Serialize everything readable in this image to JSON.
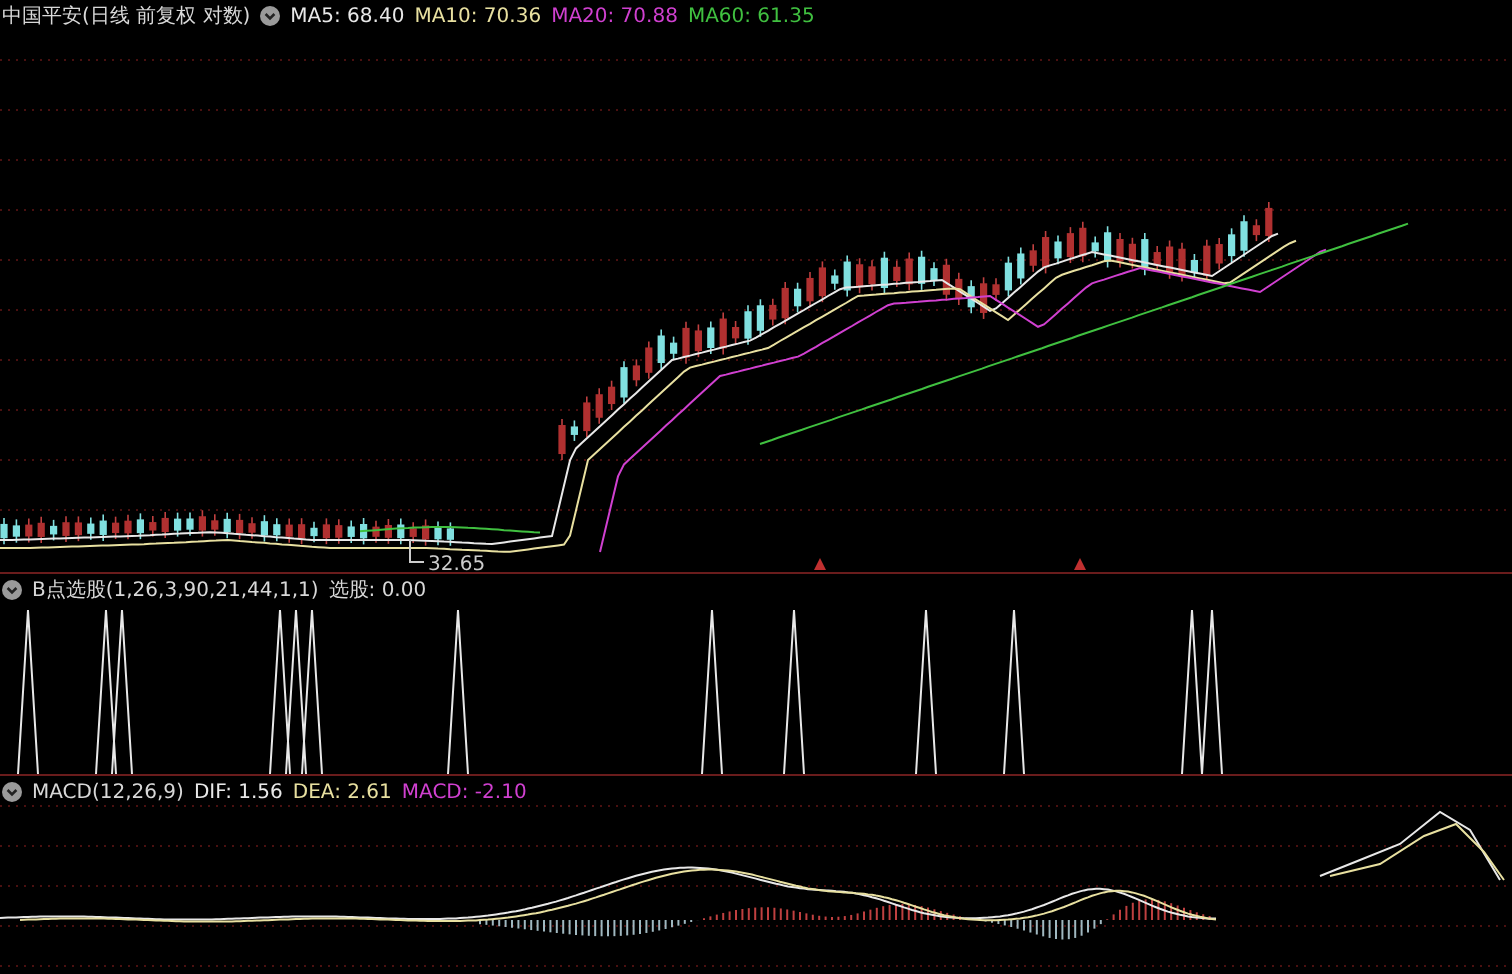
{
  "main_panel": {
    "stock_title": "中国平安(日线 前复权 对数)",
    "indicators": [
      {
        "label": "MA5: 68.40",
        "color": "#e8e8e8"
      },
      {
        "label": "MA10: 70.36",
        "color": "#e8e0a0"
      },
      {
        "label": "MA20: 70.88",
        "color": "#d040d0"
      },
      {
        "label": "MA60: 61.35",
        "color": "#40c040"
      }
    ],
    "low_marker": "32.65"
  },
  "signal_panel": {
    "title": "B点选股(1,26,3,90,21,44,1,1)",
    "reading": "选股: 0.00"
  },
  "macd_panel": {
    "title": "MACD(12,26,9)",
    "indicators": [
      {
        "label": "DIF: 1.56",
        "color": "#e8e8e8"
      },
      {
        "label": "DEA: 2.61",
        "color": "#e8e0a0"
      },
      {
        "label": "MACD: -2.10",
        "color": "#d040d0"
      }
    ]
  }
}
